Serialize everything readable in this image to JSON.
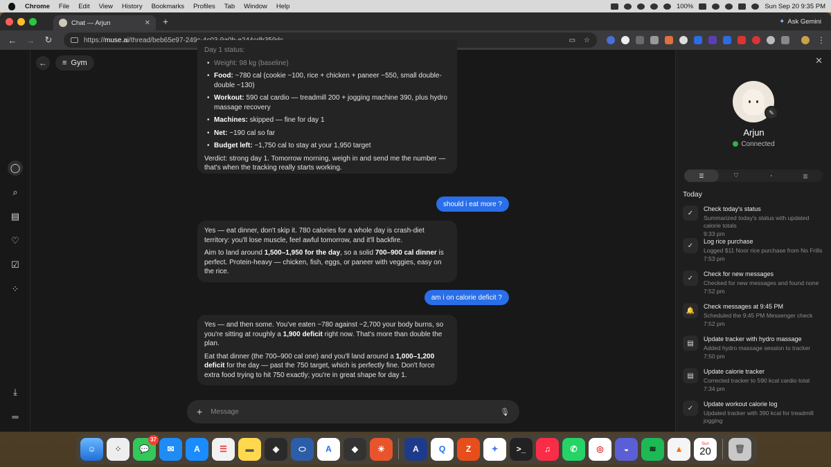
{
  "menubar": {
    "app": "Chrome",
    "items": [
      "File",
      "Edit",
      "View",
      "History",
      "Bookmarks",
      "Profiles",
      "Tab",
      "Window",
      "Help"
    ],
    "battery": "100%",
    "clock": "Sun Sep 20  9:35 PM"
  },
  "browser": {
    "tab_title": "Chat — Arjun",
    "ask_gemini": "Ask Gemini",
    "url_host": "muse.ai",
    "url_path": "/thread/beb65e97-249c-4c03-9a0b-e244cdb359dc",
    "url_scheme": "https://"
  },
  "chat": {
    "header_title": "Gym",
    "bubble1": {
      "faded_top": "Day 1 status:",
      "items": [
        {
          "label": "Weight:",
          "text": " 98 kg (baseline)"
        },
        {
          "label": "Food:",
          "text": " ~780 cal (cookie ~100, rice + chicken + paneer ~550, small double-double ~130)"
        },
        {
          "label": "Workout:",
          "text": " 590 cal cardio — treadmill 200 + jogging machine 390, plus hydro massage recovery"
        },
        {
          "label": "Machines:",
          "text": " skipped — fine for day 1"
        },
        {
          "label": "Net:",
          "text": " ~190 cal so far"
        },
        {
          "label": "Budget left:",
          "text": " ~1,750 cal to stay at your 1,950 target"
        }
      ],
      "verdict": "Verdict: strong day 1. Tomorrow morning, weigh in and send me the number — that's when the tracking really starts working."
    },
    "user1": "should i eat more ?",
    "bubble2": {
      "p1": "Yes — eat dinner, don't skip it. 780 calories for a whole day is crash-diet territory: you'll lose muscle, feel awful tomorrow, and it'll backfire.",
      "p2a": "Aim to land around ",
      "p2b": "1,500–1,950 for the day",
      "p2c": ", so a solid ",
      "p2d": "700–900 cal dinner",
      "p2e": " is perfect. Protein-heavy — chicken, fish, eggs, or paneer with veggies, easy on the rice."
    },
    "user2": "am i on calorie deficit ?",
    "bubble3": {
      "p1a": "Yes — and then some. You've eaten ~780 against ~2,700 your body burns, so you're sitting at roughly a ",
      "p1b": "1,900 deficit",
      "p1c": " right now. That's more than double the plan.",
      "p2a": "Eat that dinner (the 700–900 cal one) and you'll land around a ",
      "p2b": "1,000–1,200 deficit",
      "p2c": " for the day — past the 750 target, which is perfectly fine. Don't force extra food trying to hit 750 exactly; you're in great shape for day 1."
    },
    "composer_placeholder": "Message"
  },
  "panel": {
    "agent_name": "Arjun",
    "status": "Connected",
    "section": "Today",
    "activities": [
      {
        "title": "Check today's status",
        "desc": "Summarized today's status with updated calorie totals",
        "time": "9:33 pm",
        "icon": "check-circle-icon"
      },
      {
        "title": "Log rice purchase",
        "desc": "Logged $11 Noor rice purchase from No Frills",
        "time": "7:53 pm",
        "icon": "check-circle-icon"
      },
      {
        "title": "Check for new messages",
        "desc": "Checked for new messages and found none",
        "time": "7:52 pm",
        "icon": "check-circle-icon"
      },
      {
        "title": "Check messages at 9:45 PM",
        "desc": "Scheduled the 9:45 PM Messenger check",
        "time": "7:52 pm",
        "icon": "bell-icon"
      },
      {
        "title": "Update tracker with hydro massage",
        "desc": "Added hydro massage session to tracker",
        "time": "7:50 pm",
        "icon": "document-icon"
      },
      {
        "title": "Update calorie tracker",
        "desc": "Corrected tracker to 590 kcal cardio total",
        "time": "7:34 pm",
        "icon": "document-icon"
      },
      {
        "title": "Update workout calorie log",
        "desc": "Updated tracker with 390 kcal for treadmill jogging",
        "time": "",
        "icon": "check-circle-icon"
      }
    ]
  },
  "dock": {
    "messages_badge": "37",
    "calendar_month": "Sun",
    "calendar_day": "20"
  }
}
